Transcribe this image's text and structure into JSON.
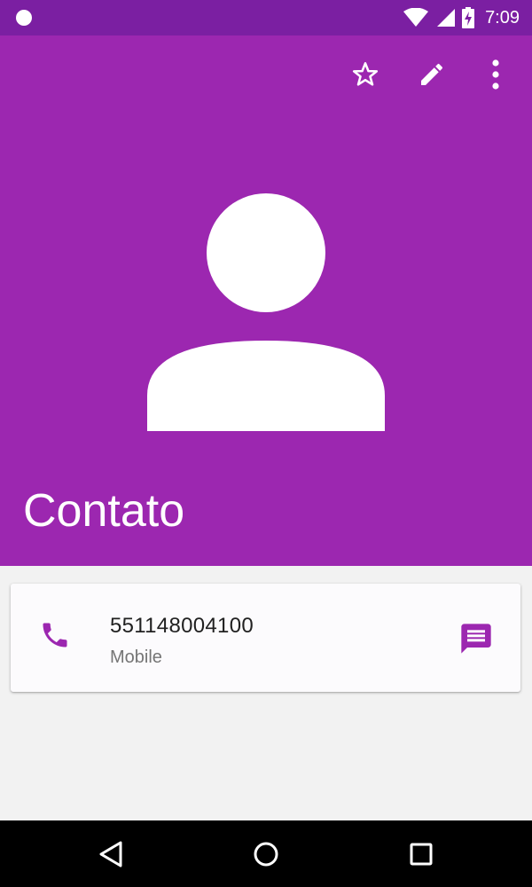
{
  "status_bar": {
    "time": "7:09",
    "icons": [
      "notification-dot-icon",
      "wifi-icon",
      "signal-icon",
      "battery-charging-icon"
    ]
  },
  "colors": {
    "status_bar": "#7b1fa2",
    "header": "#9c27b0",
    "accent": "#9c27b0",
    "background": "#f2f2f2",
    "nav_bar": "#000000"
  },
  "toolbar": {
    "actions": [
      "star-icon",
      "edit-icon",
      "more-vert-icon"
    ]
  },
  "contact": {
    "name": "Contato",
    "avatar": "person-placeholder-icon"
  },
  "phone_entry": {
    "number": "551148004100",
    "type": "Mobile",
    "leading_icon": "phone-icon",
    "trailing_icon": "message-icon"
  },
  "nav_bar": {
    "buttons": [
      "back-icon",
      "home-icon",
      "recents-icon"
    ]
  }
}
